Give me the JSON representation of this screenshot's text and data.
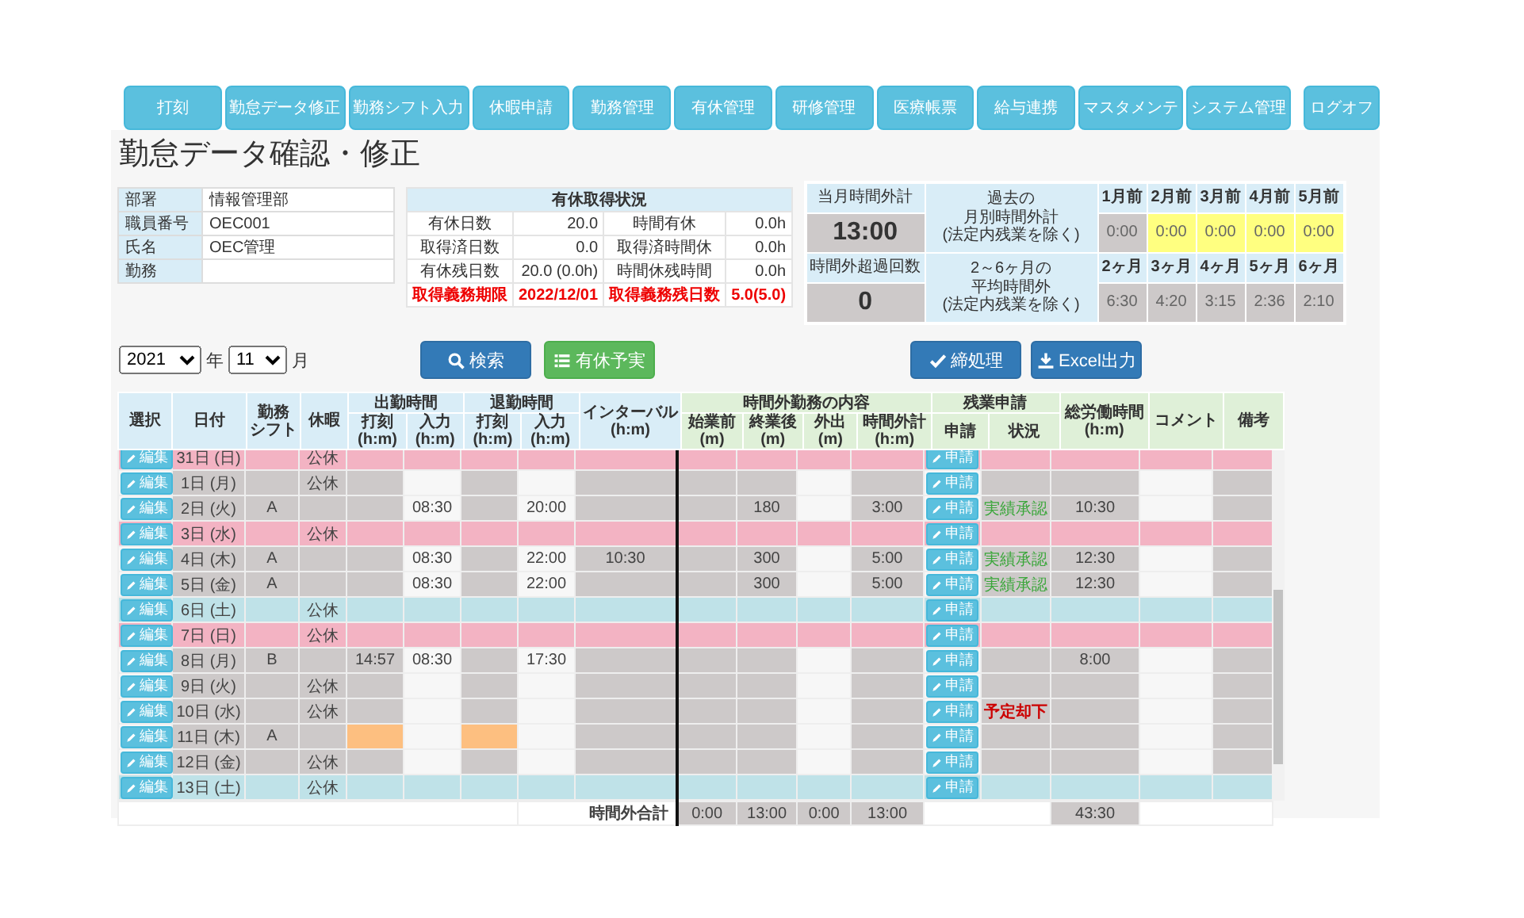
{
  "nav": {
    "items": [
      {
        "label": "打刻"
      },
      {
        "label": "勤怠データ修正"
      },
      {
        "label": "勤務シフト入力"
      },
      {
        "label": "休暇申請"
      },
      {
        "label": "勤務管理"
      },
      {
        "label": "有休管理"
      },
      {
        "label": "研修管理"
      },
      {
        "label": "医療帳票"
      },
      {
        "label": "給与連携"
      },
      {
        "label": "マスタメンテ"
      },
      {
        "label": "システム管理"
      }
    ],
    "logoff": "ログオフ"
  },
  "title": "勤怠データ確認・修正",
  "employee": [
    {
      "label": "部署",
      "value": "情報管理部"
    },
    {
      "label": "職員番号",
      "value": "OEC001"
    },
    {
      "label": "氏名",
      "value": "OEC管理"
    },
    {
      "label": "勤務"
    }
  ],
  "paid_leave": {
    "title": "有休取得状況",
    "rows": [
      {
        "cells": [
          "有休日数",
          "20.0",
          "時間有休",
          "0.0h"
        ],
        "alert": false
      },
      {
        "cells": [
          "取得済日数",
          "0.0",
          "取得済時間休",
          "0.0h"
        ],
        "alert": false
      },
      {
        "cells": [
          "有休残日数",
          "20.0 (0.0h)",
          "時間休残時間",
          "0.0h"
        ],
        "alert": false
      },
      {
        "cells": [
          "取得義務期限",
          "2022/12/01",
          "取得義務残日数",
          "5.0(5.0)"
        ],
        "alert": true
      }
    ]
  },
  "overtime_summary": {
    "current_label": "当月時間外計",
    "current_value": "13:00",
    "count_label": "時間外超過回数",
    "count_value": "0",
    "past_label": [
      "過去の",
      "月別時間外計",
      "(法定内残業を除く)"
    ],
    "avg_label": [
      "2～6ヶ月の",
      "平均時間外",
      "(法定内残業を除く)"
    ],
    "past": [
      {
        "label": "1月前",
        "value": "0:00",
        "warning": false
      },
      {
        "label": "2月前",
        "value": "0:00",
        "warning": true
      },
      {
        "label": "3月前",
        "value": "0:00",
        "warning": true
      },
      {
        "label": "4月前",
        "value": "0:00",
        "warning": true
      },
      {
        "label": "5月前",
        "value": "0:00",
        "warning": true
      }
    ],
    "average": [
      {
        "label": "2ヶ月",
        "value": "6:30"
      },
      {
        "label": "3ヶ月",
        "value": "4:20"
      },
      {
        "label": "4ヶ月",
        "value": "3:15"
      },
      {
        "label": "5ヶ月",
        "value": "2:36"
      },
      {
        "label": "6ヶ月",
        "value": "2:10"
      }
    ]
  },
  "filters": {
    "year": "2021",
    "year_unit": "年",
    "month": "11",
    "month_unit": "月"
  },
  "buttons": [
    {
      "label": "検索",
      "kind": "search"
    },
    {
      "label": "有休予実",
      "kind": "plan"
    },
    {
      "label": "締処理",
      "kind": "close"
    },
    {
      "label": "Excel出力",
      "kind": "export"
    }
  ],
  "table": {
    "header": [
      {
        "label": [
          "選択"
        ],
        "kind": "attendance"
      },
      {
        "label": [
          "日付"
        ],
        "kind": "attendance"
      },
      {
        "label": [
          "勤務",
          "シフト"
        ],
        "kind": "attendance"
      },
      {
        "label": [
          "休暇"
        ],
        "kind": "attendance"
      },
      {
        "label": [
          "出勤時間"
        ],
        "kind": "attendance",
        "children": [
          {
            "label": [
              "打刻",
              "(h:m)"
            ]
          },
          {
            "label": [
              "入力",
              "(h:m)"
            ]
          }
        ]
      },
      {
        "label": [
          "退勤時間"
        ],
        "kind": "attendance",
        "children": [
          {
            "label": [
              "打刻",
              "(h:m)"
            ]
          },
          {
            "label": [
              "入力",
              "(h:m)"
            ]
          }
        ]
      },
      {
        "label": [
          "インターバル",
          "(h:m)"
        ],
        "kind": "attendance"
      },
      {
        "label": [
          "時間外勤務の内容"
        ],
        "kind": "overtime",
        "children": [
          {
            "label": [
              "始業前",
              "(m)"
            ]
          },
          {
            "label": [
              "終業後",
              "(m)"
            ]
          },
          {
            "label": [
              "外出",
              "(m)"
            ]
          },
          {
            "label": [
              "時間外計",
              "(h:m)"
            ]
          }
        ]
      },
      {
        "label": [
          "残業申請"
        ],
        "kind": "overtime",
        "children": [
          {
            "label": [
              "申請"
            ]
          },
          {
            "label": [
              "状況"
            ]
          }
        ]
      },
      {
        "label": [
          "総労働時間",
          "(h:m)"
        ],
        "kind": "overtime"
      },
      {
        "label": [
          "コメント"
        ],
        "kind": "overtime"
      },
      {
        "label": [
          "備考"
        ],
        "kind": "overtime"
      }
    ],
    "rows": [
      {
        "kind": "holiday",
        "edit": "編集",
        "date": "31日 (日)",
        "leave": "公休",
        "apply": "申請",
        "in_alert": false,
        "out_alert": false
      },
      {
        "kind": "weekday",
        "edit": "編集",
        "date": "1日 (月)",
        "leave": "公休",
        "apply": "申請",
        "in_alert": false,
        "out_alert": false
      },
      {
        "kind": "weekday",
        "edit": "編集",
        "date": "2日 (火)",
        "shift": "A",
        "in_input": "08:30",
        "out_input": "20:00",
        "after": "180",
        "overtime": "3:00",
        "apply": "申請",
        "status": {
          "text": "実績承認",
          "kind": "approved"
        },
        "total": "10:30",
        "in_alert": false,
        "out_alert": false
      },
      {
        "kind": "holiday",
        "edit": "編集",
        "date": "3日 (水)",
        "leave": "公休",
        "apply": "申請",
        "in_alert": false,
        "out_alert": false
      },
      {
        "kind": "weekday",
        "edit": "編集",
        "date": "4日 (木)",
        "shift": "A",
        "in_input": "08:30",
        "out_input": "22:00",
        "interval": "10:30",
        "after": "300",
        "overtime": "5:00",
        "apply": "申請",
        "status": {
          "text": "実績承認",
          "kind": "approved"
        },
        "total": "12:30",
        "in_alert": false,
        "out_alert": false
      },
      {
        "kind": "weekday",
        "edit": "編集",
        "date": "5日 (金)",
        "shift": "A",
        "in_input": "08:30",
        "out_input": "22:00",
        "after": "300",
        "overtime": "5:00",
        "apply": "申請",
        "status": {
          "text": "実績承認",
          "kind": "approved"
        },
        "total": "12:30",
        "in_alert": false,
        "out_alert": false
      },
      {
        "kind": "saturday",
        "edit": "編集",
        "date": "6日 (土)",
        "leave": "公休",
        "apply": "申請",
        "in_alert": false,
        "out_alert": false
      },
      {
        "kind": "holiday",
        "edit": "編集",
        "date": "7日 (日)",
        "leave": "公休",
        "apply": "申請",
        "in_alert": false,
        "out_alert": false
      },
      {
        "kind": "weekday",
        "edit": "編集",
        "date": "8日 (月)",
        "shift": "B",
        "in_stamp": "14:57",
        "in_input": "08:30",
        "out_input": "17:30",
        "apply": "申請",
        "total": "8:00",
        "in_alert": false,
        "out_alert": false
      },
      {
        "kind": "weekday",
        "edit": "編集",
        "date": "9日 (火)",
        "leave": "公休",
        "apply": "申請",
        "in_alert": false,
        "out_alert": false
      },
      {
        "kind": "weekday",
        "edit": "編集",
        "date": "10日 (水)",
        "leave": "公休",
        "apply": "申請",
        "status": {
          "text": "予定却下",
          "kind": "rejected"
        },
        "in_alert": false,
        "out_alert": false
      },
      {
        "kind": "weekday",
        "edit": "編集",
        "date": "11日 (木)",
        "shift": "A",
        "apply": "申請",
        "in_alert": true,
        "out_alert": true
      },
      {
        "kind": "weekday",
        "edit": "編集",
        "date": "12日 (金)",
        "leave": "公休",
        "apply": "申請",
        "in_alert": false,
        "out_alert": false
      },
      {
        "kind": "saturday",
        "edit": "編集",
        "date": "13日 (土)",
        "leave": "公休",
        "apply": "申請",
        "in_alert": false,
        "out_alert": false
      }
    ],
    "footer": {
      "label": "時間外合計",
      "before": "0:00",
      "after": "13:00",
      "outing": "0:00",
      "overtime": "13:00",
      "total": "43:30"
    }
  }
}
